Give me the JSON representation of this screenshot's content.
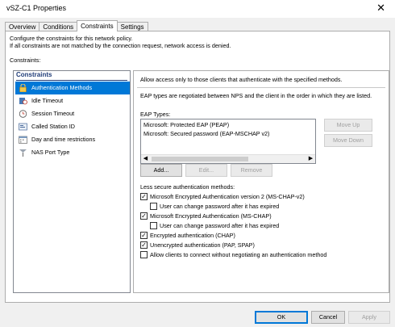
{
  "window": {
    "title": "vSZ-C1 Properties",
    "close_glyph": "✕"
  },
  "tabs": [
    "Overview",
    "Conditions",
    "Constraints",
    "Settings"
  ],
  "active_tab": "Constraints",
  "description": {
    "line1": "Configure the constraints for this network policy.",
    "line2": "If all constraints are not matched by the connection request, network access is denied."
  },
  "constraints_label": "Constraints:",
  "tree": {
    "header": "Constraints",
    "items": [
      {
        "label": "Authentication Methods",
        "icon": "lock-icon",
        "selected": true
      },
      {
        "label": "Idle Timeout",
        "icon": "idle-timeout-icon",
        "selected": false
      },
      {
        "label": "Session Timeout",
        "icon": "clock-icon",
        "selected": false
      },
      {
        "label": "Called Station ID",
        "icon": "station-id-icon",
        "selected": false
      },
      {
        "label": "Day and time restrictions",
        "icon": "calendar-icon",
        "selected": false
      },
      {
        "label": "NAS Port Type",
        "icon": "port-icon",
        "selected": false
      }
    ]
  },
  "content": {
    "header": "Allow access only to those clients that authenticate with the specified methods.",
    "eap_paragraph": "EAP types are negotiated between NPS and the client in the order in which they are listed.",
    "eap_types_label": "EAP Types:",
    "eap_types": [
      "Microsoft: Protected EAP (PEAP)",
      "Microsoft: Secured password (EAP-MSCHAP v2)"
    ],
    "move_up": "Move Up",
    "move_down": "Move Down",
    "add": "Add...",
    "edit": "Edit...",
    "remove": "Remove",
    "less_secure_label": "Less secure authentication methods:",
    "checkboxes": [
      {
        "label": "Microsoft Encrypted Authentication version 2 (MS-CHAP-v2)",
        "checked": true
      },
      {
        "label": "User can change password after it has expired",
        "checked": false
      },
      {
        "label": "Microsoft Encrypted Authentication (MS-CHAP)",
        "checked": true
      },
      {
        "label": "User can change password after it has expired",
        "checked": false
      },
      {
        "label": "Encrypted authentication (CHAP)",
        "checked": true
      },
      {
        "label": "Unencrypted authentication (PAP, SPAP)",
        "checked": true
      },
      {
        "label": "Allow clients to connect without negotiating an authentication method",
        "checked": false
      }
    ]
  },
  "footer": {
    "ok": "OK",
    "cancel": "Cancel",
    "apply": "Apply"
  }
}
